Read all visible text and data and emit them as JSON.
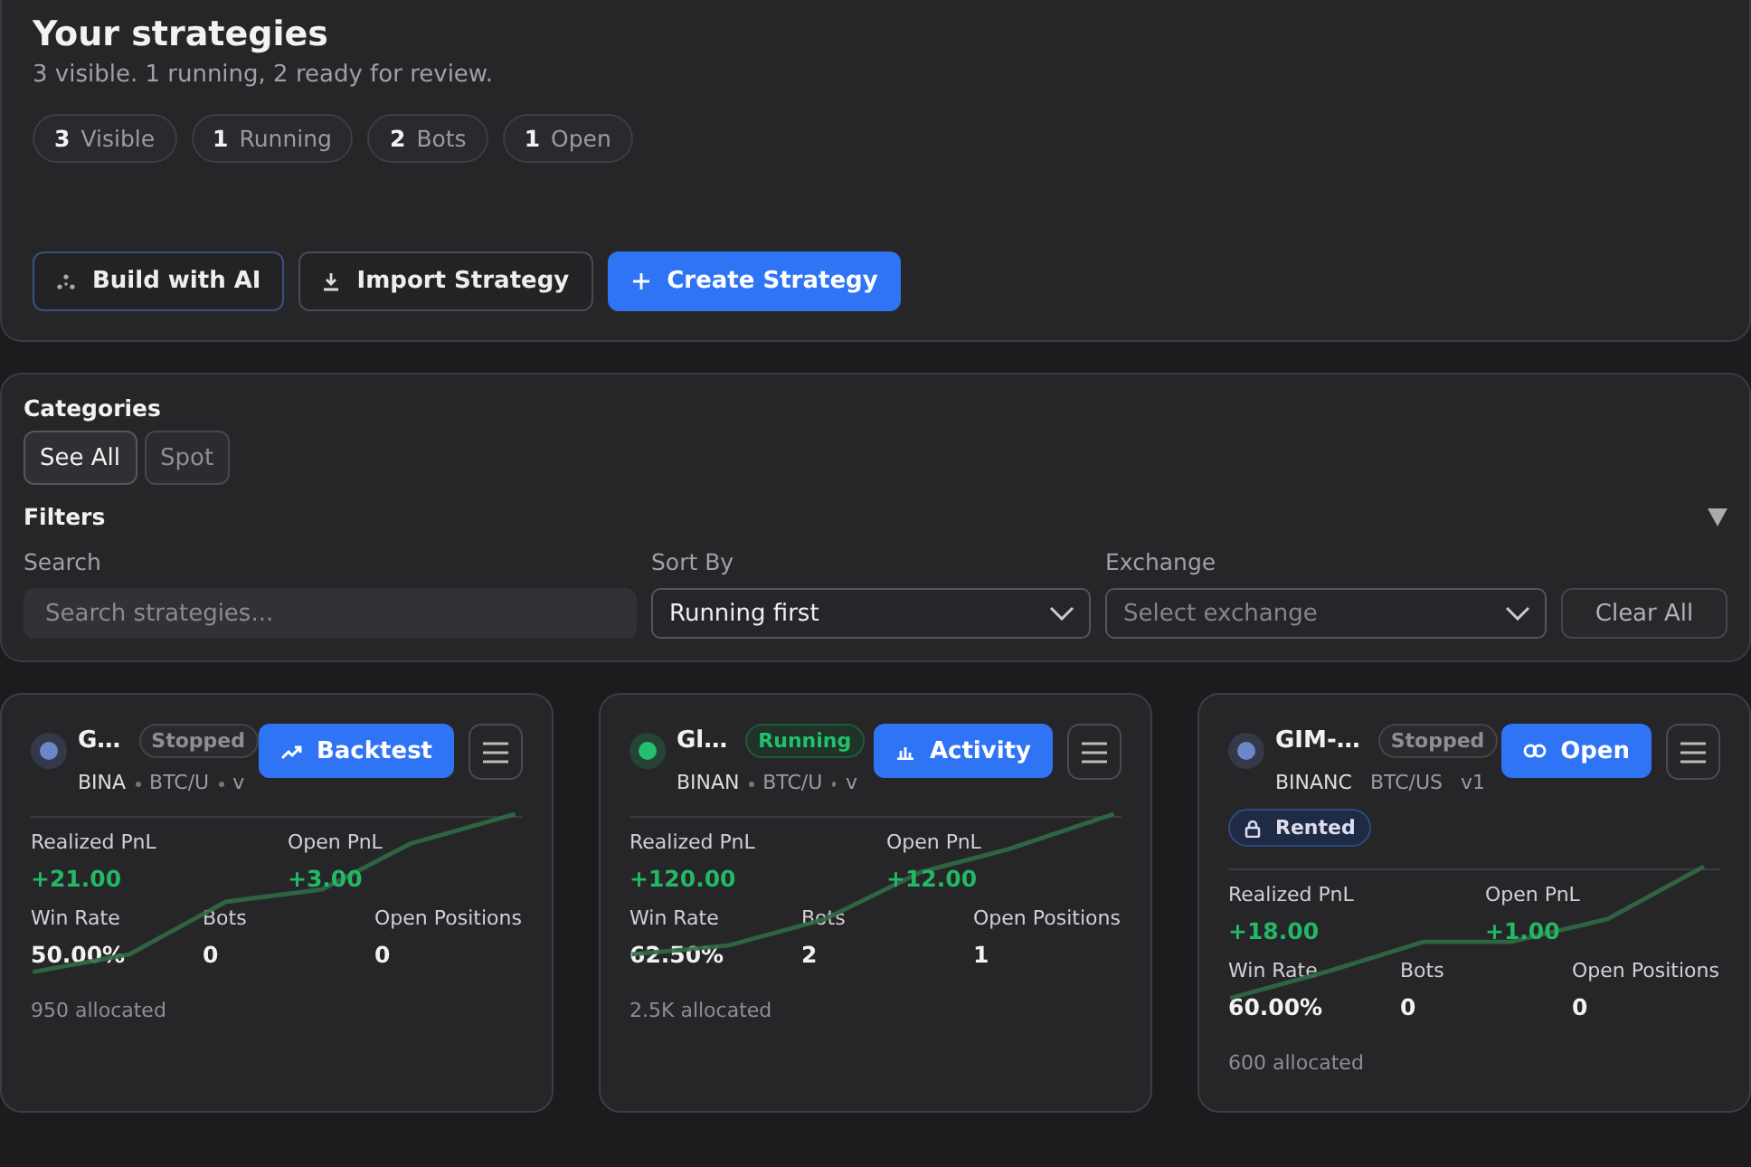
{
  "header": {
    "title": "Your strategies",
    "subtitle": "3 visible. 1 running, 2 ready for review.",
    "stats": [
      {
        "count": "3",
        "label": "Visible"
      },
      {
        "count": "1",
        "label": "Running"
      },
      {
        "count": "2",
        "label": "Bots"
      },
      {
        "count": "1",
        "label": "Open"
      }
    ],
    "buttons": [
      {
        "kind": "ai",
        "label": "Build with AI"
      },
      {
        "kind": "import",
        "label": "Import Strategy"
      },
      {
        "kind": "create",
        "label": "Create Strategy"
      }
    ]
  },
  "filters_panel": {
    "categories_title": "Categories",
    "categories": [
      {
        "label": "See All",
        "selected": true
      },
      {
        "label": "Spot",
        "selected": false
      }
    ],
    "filters_title": "Filters",
    "search": {
      "label": "Search",
      "placeholder": "Search strategies..."
    },
    "sort": {
      "label": "Sort By",
      "value": "Running first"
    },
    "exchange": {
      "label": "Exchange",
      "placeholder": "Select exchange"
    },
    "clear": "Clear All"
  },
  "cards": [
    {
      "name": "G…",
      "status": "Stopped",
      "running": false,
      "color": "#6b86c9",
      "exchange": "BINA",
      "pair": "BTC/U",
      "version": "v",
      "action": {
        "kind": "backtest",
        "label": "Backtest"
      },
      "rented": false,
      "metrics": [
        {
          "label": "Realized PnL",
          "value": "+21.00"
        },
        {
          "label": "Open PnL",
          "value": "+3.00"
        }
      ],
      "stats": [
        {
          "label": "Win Rate",
          "value": "50.00%"
        },
        {
          "label": "Bots",
          "value": "0"
        },
        {
          "label": "Open Positions",
          "value": "0"
        }
      ],
      "allocated": "950 allocated"
    },
    {
      "name": "Gl…",
      "status": "Running",
      "running": true,
      "color": "#22c06a",
      "exchange": "BINAN",
      "pair": "BTC/U",
      "version": "v",
      "action": {
        "kind": "activity",
        "label": "Activity"
      },
      "rented": false,
      "metrics": [
        {
          "label": "Realized PnL",
          "value": "+120.00"
        },
        {
          "label": "Open PnL",
          "value": "+12.00"
        }
      ],
      "stats": [
        {
          "label": "Win Rate",
          "value": "62.50%"
        },
        {
          "label": "Bots",
          "value": "2"
        },
        {
          "label": "Open Positions",
          "value": "1"
        }
      ],
      "allocated": "2.5K allocated"
    },
    {
      "name": "GIM-…",
      "status": "Stopped",
      "running": false,
      "color": "#6b86c9",
      "exchange": "BINANC",
      "pair": "BTC/US",
      "version": "v1",
      "action": {
        "kind": "open",
        "label": "Open"
      },
      "rented": true,
      "rented_label": "Rented",
      "metrics": [
        {
          "label": "Realized PnL",
          "value": "+18.00"
        },
        {
          "label": "Open PnL",
          "value": "+1.00"
        }
      ],
      "stats": [
        {
          "label": "Win Rate",
          "value": "60.00%"
        },
        {
          "label": "Bots",
          "value": "0"
        },
        {
          "label": "Open Positions",
          "value": "0"
        }
      ],
      "allocated": "600 allocated"
    }
  ]
}
